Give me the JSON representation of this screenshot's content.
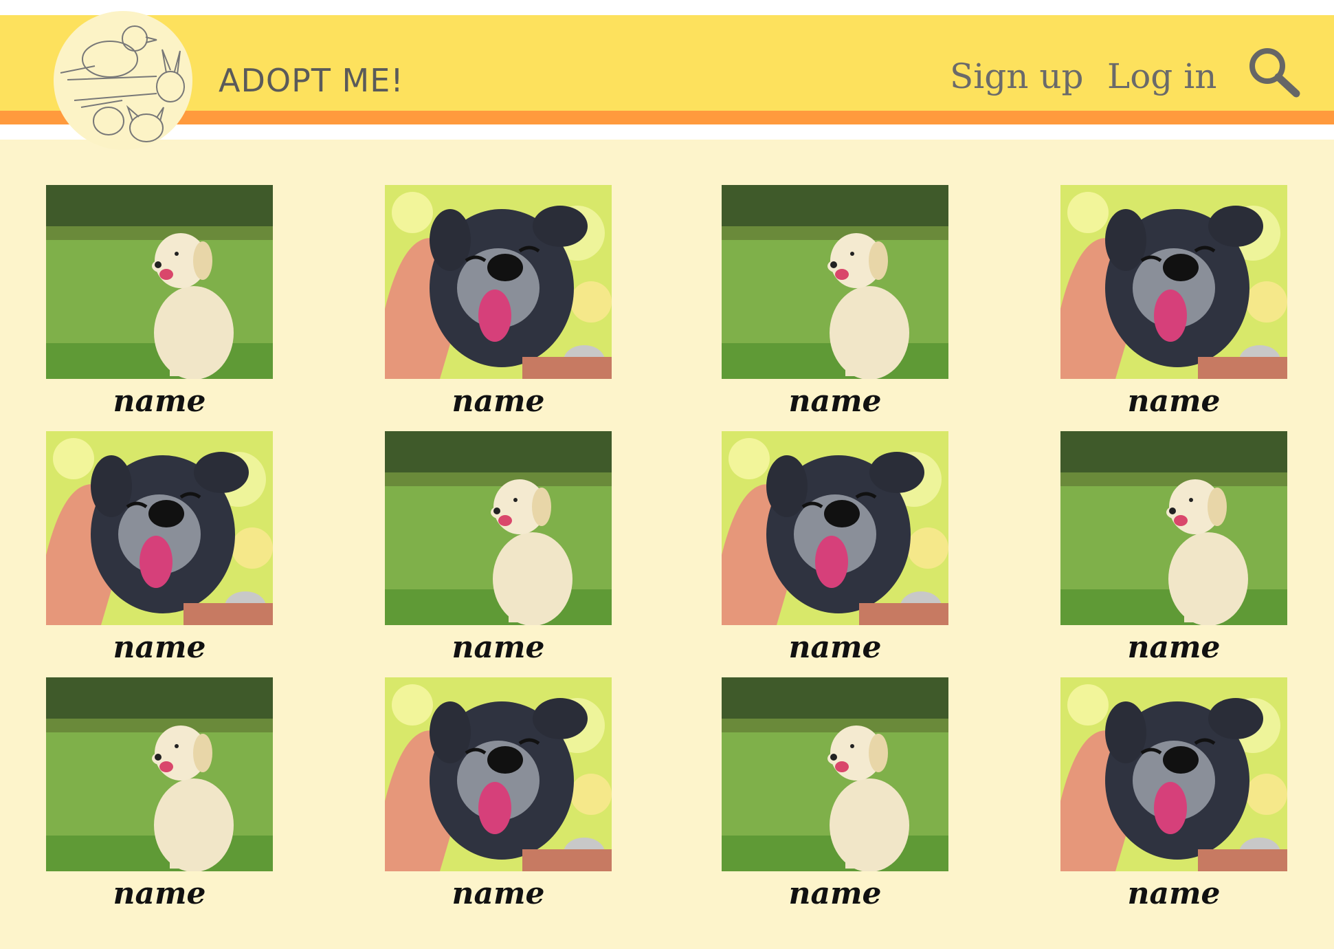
{
  "header": {
    "brand": "ADOPT ME!",
    "nav": {
      "signup": "Sign up",
      "login": "Log in"
    }
  },
  "colors": {
    "header": "#fde15d",
    "stripe": "#ff9a3d",
    "background": "#fdf4cb",
    "text": "#5a5a5a"
  },
  "grid": {
    "cards": [
      {
        "name": "name",
        "photo": "golden-retriever-puppy"
      },
      {
        "name": "name",
        "photo": "happy-black-dog"
      },
      {
        "name": "name",
        "photo": "golden-retriever-puppy"
      },
      {
        "name": "name",
        "photo": "happy-black-dog"
      },
      {
        "name": "name",
        "photo": "happy-black-dog"
      },
      {
        "name": "name",
        "photo": "golden-retriever-puppy"
      },
      {
        "name": "name",
        "photo": "happy-black-dog"
      },
      {
        "name": "name",
        "photo": "golden-retriever-puppy"
      },
      {
        "name": "name",
        "photo": "golden-retriever-puppy"
      },
      {
        "name": "name",
        "photo": "happy-black-dog"
      },
      {
        "name": "name",
        "photo": "golden-retriever-puppy"
      },
      {
        "name": "name",
        "photo": "happy-black-dog"
      }
    ]
  }
}
